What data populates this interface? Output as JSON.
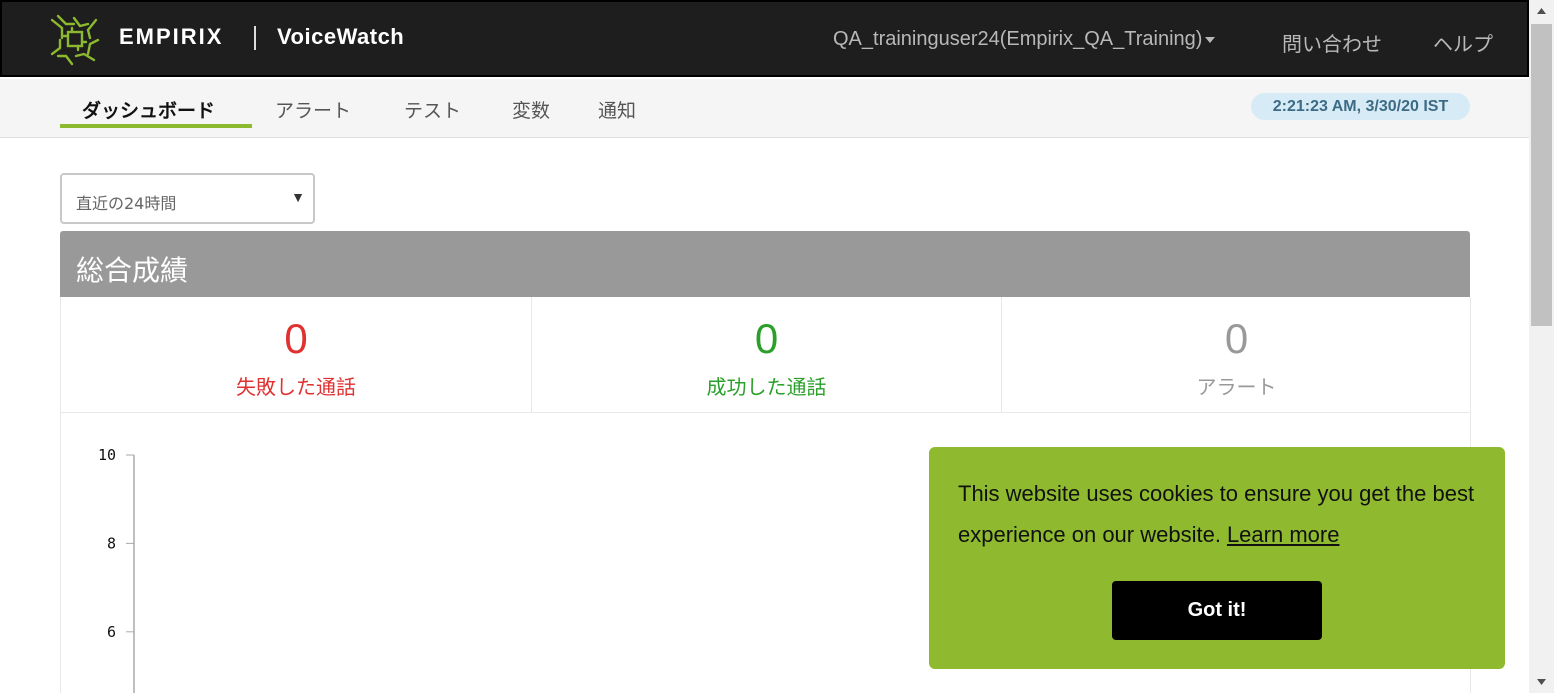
{
  "header": {
    "brand": "EMPIRIX",
    "product": "VoiceWatch",
    "user": "QA_traininguser24(Empirix_QA_Training)",
    "contact": "問い合わせ",
    "help": "ヘルプ"
  },
  "nav": {
    "tabs": [
      {
        "label": "ダッシュボード",
        "active": true
      },
      {
        "label": "アラート",
        "active": false
      },
      {
        "label": "テスト",
        "active": false
      },
      {
        "label": "変数",
        "active": false
      },
      {
        "label": "通知",
        "active": false
      }
    ],
    "timestamp": "2:21:23 AM, 3/30/20 IST"
  },
  "filter": {
    "range": "直近の24時間"
  },
  "panel": {
    "title": "総合成績",
    "stats": [
      {
        "value": "0",
        "label": "失敗した通話",
        "color": "#e03030"
      },
      {
        "value": "0",
        "label": "成功した通話",
        "color": "#2aa02a"
      },
      {
        "value": "0",
        "label": "アラート",
        "color": "#999999"
      }
    ]
  },
  "chart_data": {
    "type": "line",
    "y_ticks": [
      "10",
      "8",
      "6"
    ],
    "ylim": [
      0,
      10
    ],
    "series": []
  },
  "cookie": {
    "message": "This website uses cookies to ensure you get the best experience on our website.",
    "link": "Learn more",
    "button": "Got it!"
  },
  "colors": {
    "accent": "#8cb92e",
    "topbar": "#1e1e1e",
    "panel_header": "#999999"
  }
}
